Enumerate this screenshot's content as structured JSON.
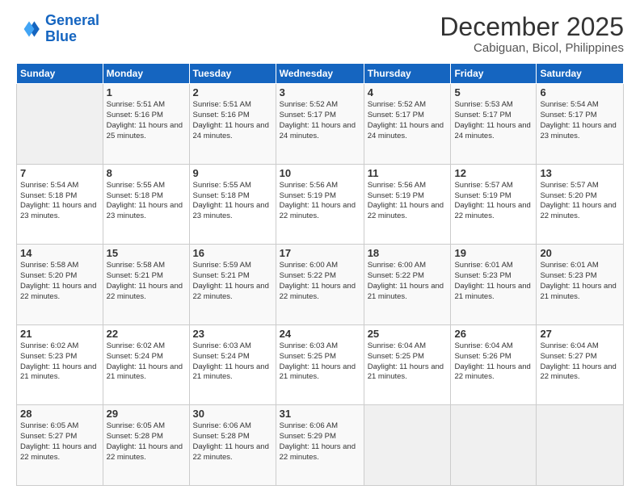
{
  "header": {
    "logo_general": "General",
    "logo_blue": "Blue",
    "month_title": "December 2025",
    "location": "Cabiguan, Bicol, Philippines"
  },
  "columns": [
    "Sunday",
    "Monday",
    "Tuesday",
    "Wednesday",
    "Thursday",
    "Friday",
    "Saturday"
  ],
  "weeks": [
    [
      {
        "day": "",
        "sunrise": "",
        "sunset": "",
        "daylight": ""
      },
      {
        "day": "1",
        "sunrise": "Sunrise: 5:51 AM",
        "sunset": "Sunset: 5:16 PM",
        "daylight": "Daylight: 11 hours and 25 minutes."
      },
      {
        "day": "2",
        "sunrise": "Sunrise: 5:51 AM",
        "sunset": "Sunset: 5:16 PM",
        "daylight": "Daylight: 11 hours and 24 minutes."
      },
      {
        "day": "3",
        "sunrise": "Sunrise: 5:52 AM",
        "sunset": "Sunset: 5:17 PM",
        "daylight": "Daylight: 11 hours and 24 minutes."
      },
      {
        "day": "4",
        "sunrise": "Sunrise: 5:52 AM",
        "sunset": "Sunset: 5:17 PM",
        "daylight": "Daylight: 11 hours and 24 minutes."
      },
      {
        "day": "5",
        "sunrise": "Sunrise: 5:53 AM",
        "sunset": "Sunset: 5:17 PM",
        "daylight": "Daylight: 11 hours and 24 minutes."
      },
      {
        "day": "6",
        "sunrise": "Sunrise: 5:54 AM",
        "sunset": "Sunset: 5:17 PM",
        "daylight": "Daylight: 11 hours and 23 minutes."
      }
    ],
    [
      {
        "day": "7",
        "sunrise": "Sunrise: 5:54 AM",
        "sunset": "Sunset: 5:18 PM",
        "daylight": "Daylight: 11 hours and 23 minutes."
      },
      {
        "day": "8",
        "sunrise": "Sunrise: 5:55 AM",
        "sunset": "Sunset: 5:18 PM",
        "daylight": "Daylight: 11 hours and 23 minutes."
      },
      {
        "day": "9",
        "sunrise": "Sunrise: 5:55 AM",
        "sunset": "Sunset: 5:18 PM",
        "daylight": "Daylight: 11 hours and 23 minutes."
      },
      {
        "day": "10",
        "sunrise": "Sunrise: 5:56 AM",
        "sunset": "Sunset: 5:19 PM",
        "daylight": "Daylight: 11 hours and 22 minutes."
      },
      {
        "day": "11",
        "sunrise": "Sunrise: 5:56 AM",
        "sunset": "Sunset: 5:19 PM",
        "daylight": "Daylight: 11 hours and 22 minutes."
      },
      {
        "day": "12",
        "sunrise": "Sunrise: 5:57 AM",
        "sunset": "Sunset: 5:19 PM",
        "daylight": "Daylight: 11 hours and 22 minutes."
      },
      {
        "day": "13",
        "sunrise": "Sunrise: 5:57 AM",
        "sunset": "Sunset: 5:20 PM",
        "daylight": "Daylight: 11 hours and 22 minutes."
      }
    ],
    [
      {
        "day": "14",
        "sunrise": "Sunrise: 5:58 AM",
        "sunset": "Sunset: 5:20 PM",
        "daylight": "Daylight: 11 hours and 22 minutes."
      },
      {
        "day": "15",
        "sunrise": "Sunrise: 5:58 AM",
        "sunset": "Sunset: 5:21 PM",
        "daylight": "Daylight: 11 hours and 22 minutes."
      },
      {
        "day": "16",
        "sunrise": "Sunrise: 5:59 AM",
        "sunset": "Sunset: 5:21 PM",
        "daylight": "Daylight: 11 hours and 22 minutes."
      },
      {
        "day": "17",
        "sunrise": "Sunrise: 6:00 AM",
        "sunset": "Sunset: 5:22 PM",
        "daylight": "Daylight: 11 hours and 22 minutes."
      },
      {
        "day": "18",
        "sunrise": "Sunrise: 6:00 AM",
        "sunset": "Sunset: 5:22 PM",
        "daylight": "Daylight: 11 hours and 21 minutes."
      },
      {
        "day": "19",
        "sunrise": "Sunrise: 6:01 AM",
        "sunset": "Sunset: 5:23 PM",
        "daylight": "Daylight: 11 hours and 21 minutes."
      },
      {
        "day": "20",
        "sunrise": "Sunrise: 6:01 AM",
        "sunset": "Sunset: 5:23 PM",
        "daylight": "Daylight: 11 hours and 21 minutes."
      }
    ],
    [
      {
        "day": "21",
        "sunrise": "Sunrise: 6:02 AM",
        "sunset": "Sunset: 5:23 PM",
        "daylight": "Daylight: 11 hours and 21 minutes."
      },
      {
        "day": "22",
        "sunrise": "Sunrise: 6:02 AM",
        "sunset": "Sunset: 5:24 PM",
        "daylight": "Daylight: 11 hours and 21 minutes."
      },
      {
        "day": "23",
        "sunrise": "Sunrise: 6:03 AM",
        "sunset": "Sunset: 5:24 PM",
        "daylight": "Daylight: 11 hours and 21 minutes."
      },
      {
        "day": "24",
        "sunrise": "Sunrise: 6:03 AM",
        "sunset": "Sunset: 5:25 PM",
        "daylight": "Daylight: 11 hours and 21 minutes."
      },
      {
        "day": "25",
        "sunrise": "Sunrise: 6:04 AM",
        "sunset": "Sunset: 5:25 PM",
        "daylight": "Daylight: 11 hours and 21 minutes."
      },
      {
        "day": "26",
        "sunrise": "Sunrise: 6:04 AM",
        "sunset": "Sunset: 5:26 PM",
        "daylight": "Daylight: 11 hours and 22 minutes."
      },
      {
        "day": "27",
        "sunrise": "Sunrise: 6:04 AM",
        "sunset": "Sunset: 5:27 PM",
        "daylight": "Daylight: 11 hours and 22 minutes."
      }
    ],
    [
      {
        "day": "28",
        "sunrise": "Sunrise: 6:05 AM",
        "sunset": "Sunset: 5:27 PM",
        "daylight": "Daylight: 11 hours and 22 minutes."
      },
      {
        "day": "29",
        "sunrise": "Sunrise: 6:05 AM",
        "sunset": "Sunset: 5:28 PM",
        "daylight": "Daylight: 11 hours and 22 minutes."
      },
      {
        "day": "30",
        "sunrise": "Sunrise: 6:06 AM",
        "sunset": "Sunset: 5:28 PM",
        "daylight": "Daylight: 11 hours and 22 minutes."
      },
      {
        "day": "31",
        "sunrise": "Sunrise: 6:06 AM",
        "sunset": "Sunset: 5:29 PM",
        "daylight": "Daylight: 11 hours and 22 minutes."
      },
      {
        "day": "",
        "sunrise": "",
        "sunset": "",
        "daylight": ""
      },
      {
        "day": "",
        "sunrise": "",
        "sunset": "",
        "daylight": ""
      },
      {
        "day": "",
        "sunrise": "",
        "sunset": "",
        "daylight": ""
      }
    ]
  ]
}
